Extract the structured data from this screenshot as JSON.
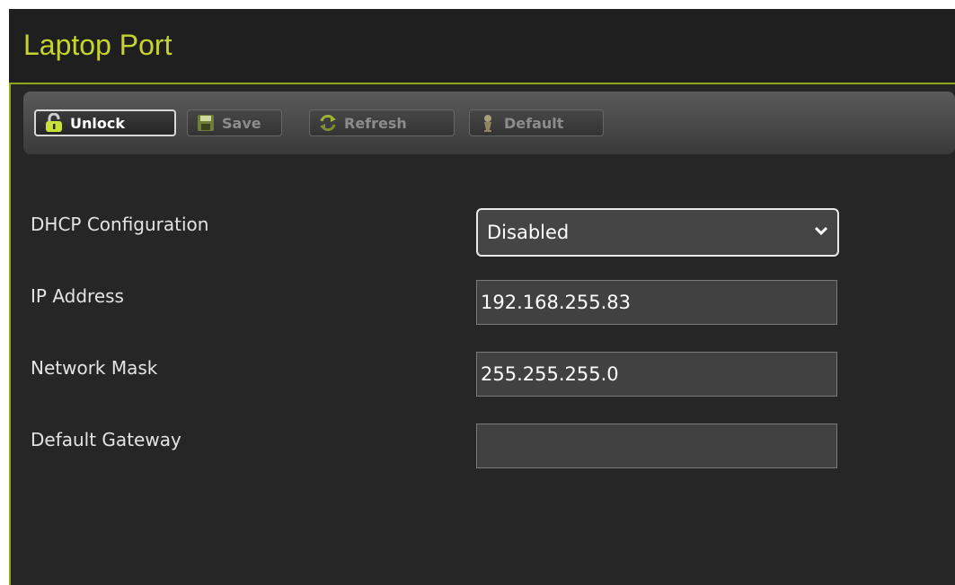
{
  "header": {
    "title": "Laptop Port"
  },
  "toolbar": {
    "buttons": [
      {
        "label": "Unlock",
        "icon": "lock-icon",
        "active": true
      },
      {
        "label": "Save",
        "icon": "floppy-disk-icon",
        "active": false
      },
      {
        "label": "Refresh",
        "icon": "refresh-icon",
        "active": false
      },
      {
        "label": "Default",
        "icon": "default-icon",
        "active": false
      }
    ]
  },
  "form": {
    "dhcp": {
      "label": "DHCP Configuration",
      "value": "Disabled"
    },
    "ip": {
      "label": "IP Address",
      "value": "192.168.255.83"
    },
    "mask": {
      "label": "Network Mask",
      "value": "255.255.255.0"
    },
    "gateway": {
      "label": "Default Gateway",
      "value": ""
    }
  },
  "colors": {
    "accent": "#c6d42e",
    "border_accent": "#94a51e",
    "background": "#262626"
  }
}
